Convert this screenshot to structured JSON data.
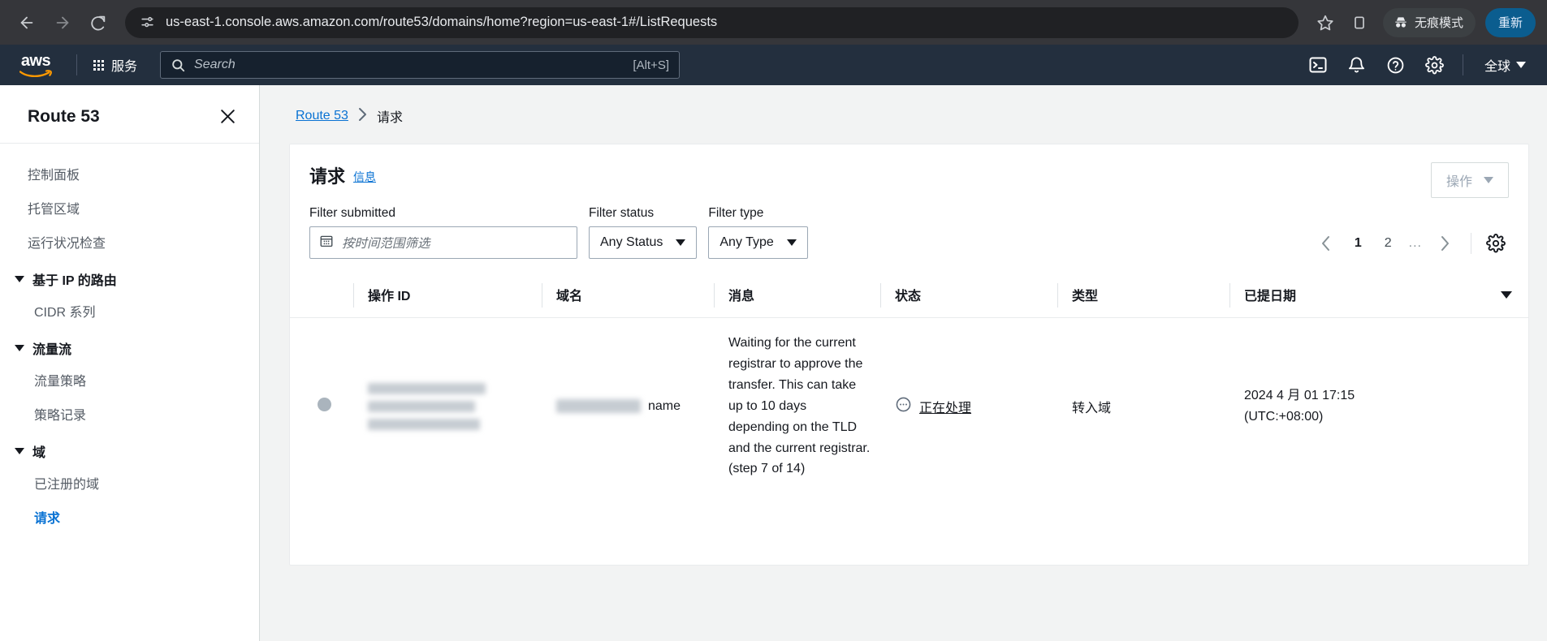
{
  "browser": {
    "back_label": "back-arrow",
    "forward_label": "forward-arrow",
    "reload_label": "reload",
    "url": "us-east-1.console.aws.amazon.com/route53/domains/home?region=us-east-1#/ListRequests",
    "incognito_label": "无痕模式",
    "update_label": "重新"
  },
  "aws_header": {
    "logo": "aws",
    "services_label": "服务",
    "search_placeholder": "Search",
    "search_shortcut": "[Alt+S]",
    "region_label": "全球",
    "icons": {
      "cloudshell": "cloudshell-icon",
      "notifications": "bell-icon",
      "help": "help-icon",
      "settings": "gear-icon"
    }
  },
  "sidebar": {
    "title": "Route 53",
    "items": [
      {
        "label": "控制面板",
        "active": false
      },
      {
        "label": "托管区域",
        "active": false
      },
      {
        "label": "运行状况检查",
        "active": false
      }
    ],
    "groups": [
      {
        "label": "基于 IP 的路由",
        "items": [
          {
            "label": "CIDR 系列",
            "active": false
          }
        ]
      },
      {
        "label": "流量流",
        "items": [
          {
            "label": "流量策略",
            "active": false
          },
          {
            "label": "策略记录",
            "active": false
          }
        ]
      },
      {
        "label": "域",
        "items": [
          {
            "label": "已注册的域",
            "active": false
          },
          {
            "label": "请求",
            "active": true
          }
        ]
      }
    ]
  },
  "breadcrumb": {
    "root": "Route 53",
    "separator": "›",
    "current": "请求"
  },
  "panel": {
    "title": "请求",
    "info_link": "信息",
    "actions_label": "操作"
  },
  "filters": {
    "submitted_label": "Filter submitted",
    "submitted_placeholder": "按时间范围筛选",
    "status_label": "Filter status",
    "status_value": "Any Status",
    "type_label": "Filter type",
    "type_value": "Any Type"
  },
  "pagination": {
    "prev": "‹",
    "pages": [
      "1",
      "2"
    ],
    "current_page": "1",
    "ellipsis": "...",
    "next": "›",
    "settings_icon": "gear-icon"
  },
  "table": {
    "columns": [
      "操作 ID",
      "域名",
      "消息",
      "状态",
      "类型",
      "已提日期"
    ],
    "rows": [
      {
        "operation_id": "",
        "domain_name_suffix": "name",
        "message": "Waiting for the current registrar to approve the transfer. This can take up to 10 days depending on the TLD and the current registrar. (step 7 of 14)",
        "status": "正在处理",
        "type": "转入域",
        "submitted_date_line1": "2024 4 月 01 17:15",
        "submitted_date_line2": "(UTC:+08:00)"
      }
    ]
  }
}
